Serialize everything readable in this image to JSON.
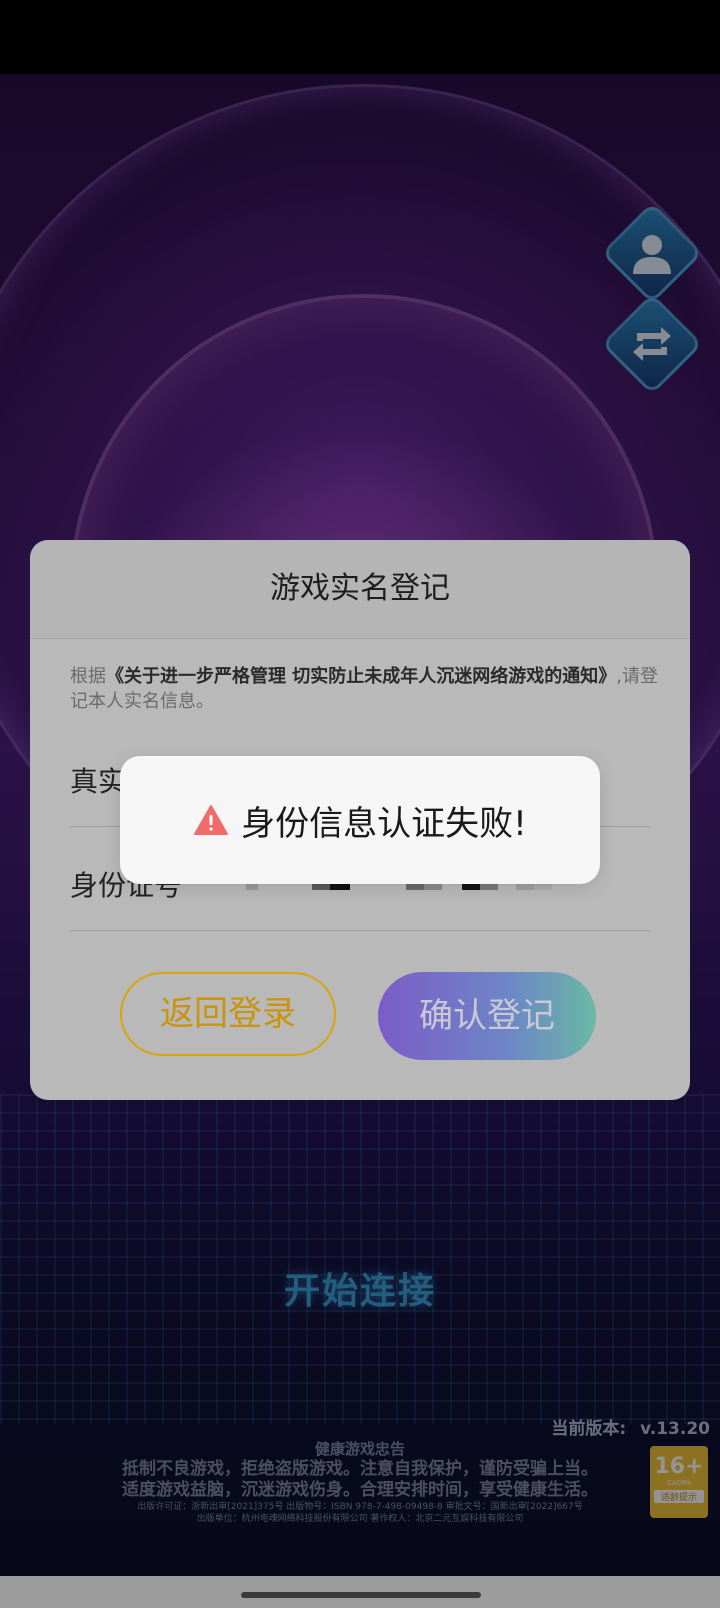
{
  "game": {
    "start_label": "开始连接",
    "version_label": "当前版本:",
    "version_value": "v.13.20",
    "health_title": "健康游戏忠告",
    "health_line1": "抵制不良游戏，拒绝盗版游戏。注意自我保护，谨防受骗上当。",
    "health_line2": "适度游戏益脑，沉迷游戏伤身。合理安排时间，享受健康生活。",
    "publish_line1": "出版许可证：浙新出审[2021]375号 出版物号：ISBN 978-7-498-09498-8 审批文号：国新出审[2022]667号",
    "publish_line2": "出版单位：杭州电魂网络科技股份有限公司 著作权人：北京二元互娱科技有限公司",
    "age_rating": "16+",
    "age_org": "CADPA",
    "age_tip": "适龄提示",
    "side_buttons": [
      {
        "icon": "user-icon"
      },
      {
        "icon": "switch-account-icon"
      }
    ]
  },
  "dialog": {
    "title": "游戏实名登记",
    "notice_prefix": "根据",
    "notice_law": "《关于进一步严格管理 切实防止未成年人沉迷网络游戏的通知》",
    "notice_suffix": ",请登记本人实名信息。",
    "name_label": "真实姓名",
    "id_label": "身份证号",
    "back_button": "返回登录",
    "confirm_button": "确认登记"
  },
  "toast": {
    "icon": "warning-icon",
    "icon_color": "#f26b6b",
    "message": "身份信息认证失败!"
  }
}
